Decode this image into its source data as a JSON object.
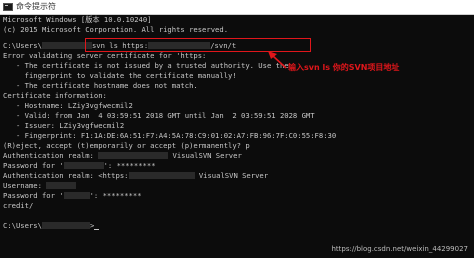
{
  "window": {
    "title": "命令提示符"
  },
  "terminal": {
    "lines": [
      "Microsoft Windows [版本 10.0.10240]",
      "(c) 2015 Microsoft Corporation. All rights reserved.",
      "",
      "C:\\Users\\",
      "svn ls https:",
      "/svn/t",
      "Error validating server certificate for 'https:",
      "   - The certificate is not issued by a trusted authority. Use the",
      "     fingerprint to validate the certificate manually!",
      "   - The certificate hostname does not match.",
      "Certificate information:",
      "   - Hostname: LZiy3vgfwecmil2",
      "   - Valid: from Jan  4 03:59:51 2018 GMT until Jan  2 03:59:51 2028 GMT",
      "   - Issuer: LZiy3vgfwecmil2",
      "   - Fingerprint: F1:1A:DE:6A:51:F7:A4:5A:78:C9:01:02:A7:FB:96:7F:C0:55:F8:30",
      "(R)eject, accept (t)emporarily or accept (p)ermanently? p",
      "Authentication realm: ",
      "VisualSVN Server",
      "Password for '",
      "': *********",
      "Authentication realm: <https:",
      "VisualSVN Server",
      "Username: ",
      "Password for '",
      "': *********",
      "credit/",
      "",
      "C:\\Users\\",
      ">"
    ]
  },
  "annotation": {
    "text": "输入svn ls 你的SVN项目地址",
    "color": "#e0161b"
  },
  "watermark": {
    "text": "https://blog.csdn.net/weixin_44299027"
  },
  "colors": {
    "terminal_bg": "#0c0c0c",
    "terminal_text": "#c8c8c8",
    "accent_red": "#e0161b"
  }
}
